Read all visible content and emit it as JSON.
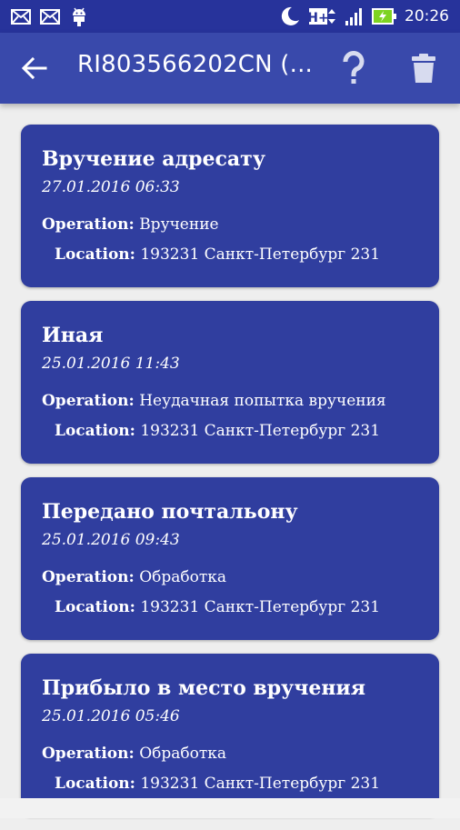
{
  "status_bar": {
    "time": "20:26",
    "network": "H+",
    "icons": [
      "mail-icon",
      "mail-icon",
      "android-icon",
      "moon-icon",
      "network-h-plus-icon",
      "signal-icon",
      "battery-charging-icon"
    ]
  },
  "app_bar": {
    "title": "RI803566202CN (...",
    "icons": [
      "arrow-back-icon",
      "help-icon",
      "trash-icon"
    ]
  },
  "events": [
    {
      "title": "Вручение адресату",
      "date": "27.01.2016 06:33",
      "operation_label": "Operation:",
      "operation": "Вручение",
      "location_label": "Location:",
      "location": "193231 Санкт-Петербург 231"
    },
    {
      "title": "Иная",
      "date": "25.01.2016 11:43",
      "operation_label": "Operation:",
      "operation": "Неудачная попытка вручения",
      "location_label": "Location:",
      "location": "193231 Санкт-Петербург 231"
    },
    {
      "title": "Передано почтальону",
      "date": "25.01.2016 09:43",
      "operation_label": "Operation:",
      "operation": "Обработка",
      "location_label": "Location:",
      "location": "193231 Санкт-Петербург 231"
    },
    {
      "title": "Прибыло в место вручения",
      "date": "25.01.2016 05:46",
      "operation_label": "Operation:",
      "operation": "Обработка",
      "location_label": "Location:",
      "location": "193231 Санкт-Петербург 231"
    }
  ],
  "colors": {
    "status_bar": "#27339b",
    "app_bar": "#3949ab",
    "card": "#303e9f",
    "background": "#eeeeee",
    "battery": "#7ed321"
  }
}
